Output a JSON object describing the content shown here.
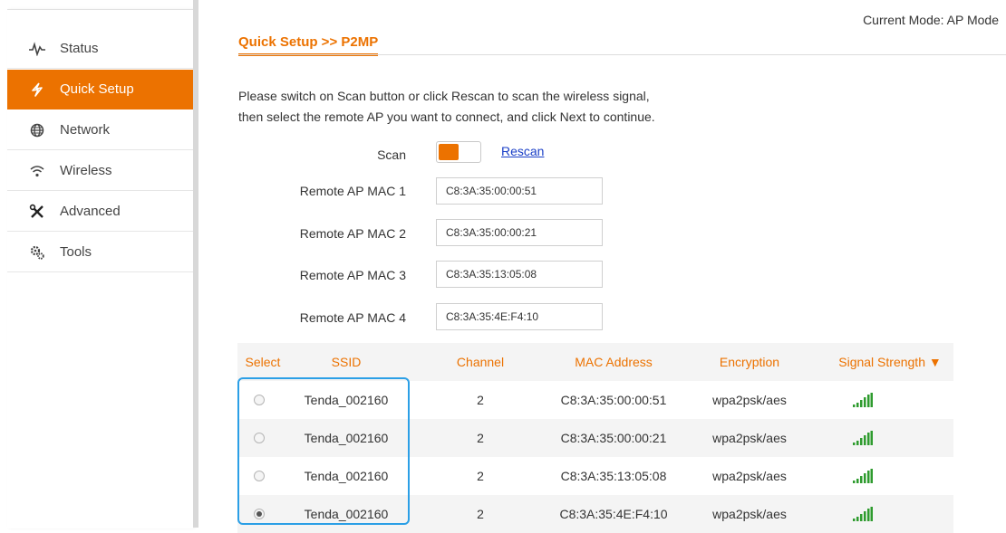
{
  "header": {
    "mode_label": "Current Mode: AP Mode"
  },
  "page": {
    "title": "Quick Setup >>  P2MP",
    "desc_line1": "Please switch on Scan button or click Rescan to scan the wireless signal,",
    "desc_line2": "then select the remote AP you want to connect, and click Next to continue."
  },
  "sidebar": {
    "items": [
      {
        "label": "Status",
        "icon": "pulse-icon",
        "active": false
      },
      {
        "label": "Quick Setup",
        "icon": "lightning-icon",
        "active": true
      },
      {
        "label": "Network",
        "icon": "globe-icon",
        "active": false
      },
      {
        "label": "Wireless",
        "icon": "wifi-icon",
        "active": false
      },
      {
        "label": "Advanced",
        "icon": "tools-cross-icon",
        "active": false
      },
      {
        "label": "Tools",
        "icon": "gears-icon",
        "active": false
      }
    ]
  },
  "scan": {
    "label": "Scan",
    "enabled": true,
    "rescan_label": "Rescan"
  },
  "macs": [
    {
      "label": "Remote AP MAC 1",
      "value": "C8:3A:35:00:00:51"
    },
    {
      "label": "Remote AP MAC 2",
      "value": "C8:3A:35:00:00:21"
    },
    {
      "label": "Remote AP MAC 3",
      "value": "C8:3A:35:13:05:08"
    },
    {
      "label": "Remote AP MAC 4",
      "value": "C8:3A:35:4E:F4:10"
    }
  ],
  "table": {
    "headers": {
      "select": "Select",
      "ssid": "SSID",
      "channel": "Channel",
      "mac": "MAC Address",
      "encryption": "Encryption",
      "signal": "Signal Strength ▼"
    },
    "rows": [
      {
        "ssid": "Tenda_002160",
        "channel": "2",
        "mac": "C8:3A:35:00:00:51",
        "encryption": "wpa2psk/aes",
        "selected": false
      },
      {
        "ssid": "Tenda_002160",
        "channel": "2",
        "mac": "C8:3A:35:00:00:21",
        "encryption": "wpa2psk/aes",
        "selected": false
      },
      {
        "ssid": "Tenda_002160",
        "channel": "2",
        "mac": "C8:3A:35:13:05:08",
        "encryption": "wpa2psk/aes",
        "selected": false
      },
      {
        "ssid": "Tenda_002160",
        "channel": "2",
        "mac": "C8:3A:35:4E:F4:10",
        "encryption": "wpa2psk/aes",
        "selected": true
      }
    ]
  },
  "colors": {
    "accent": "#ec7200",
    "link": "#1a3fc7",
    "highlight": "#2b9fe6",
    "signal": "#2e9b2e"
  }
}
